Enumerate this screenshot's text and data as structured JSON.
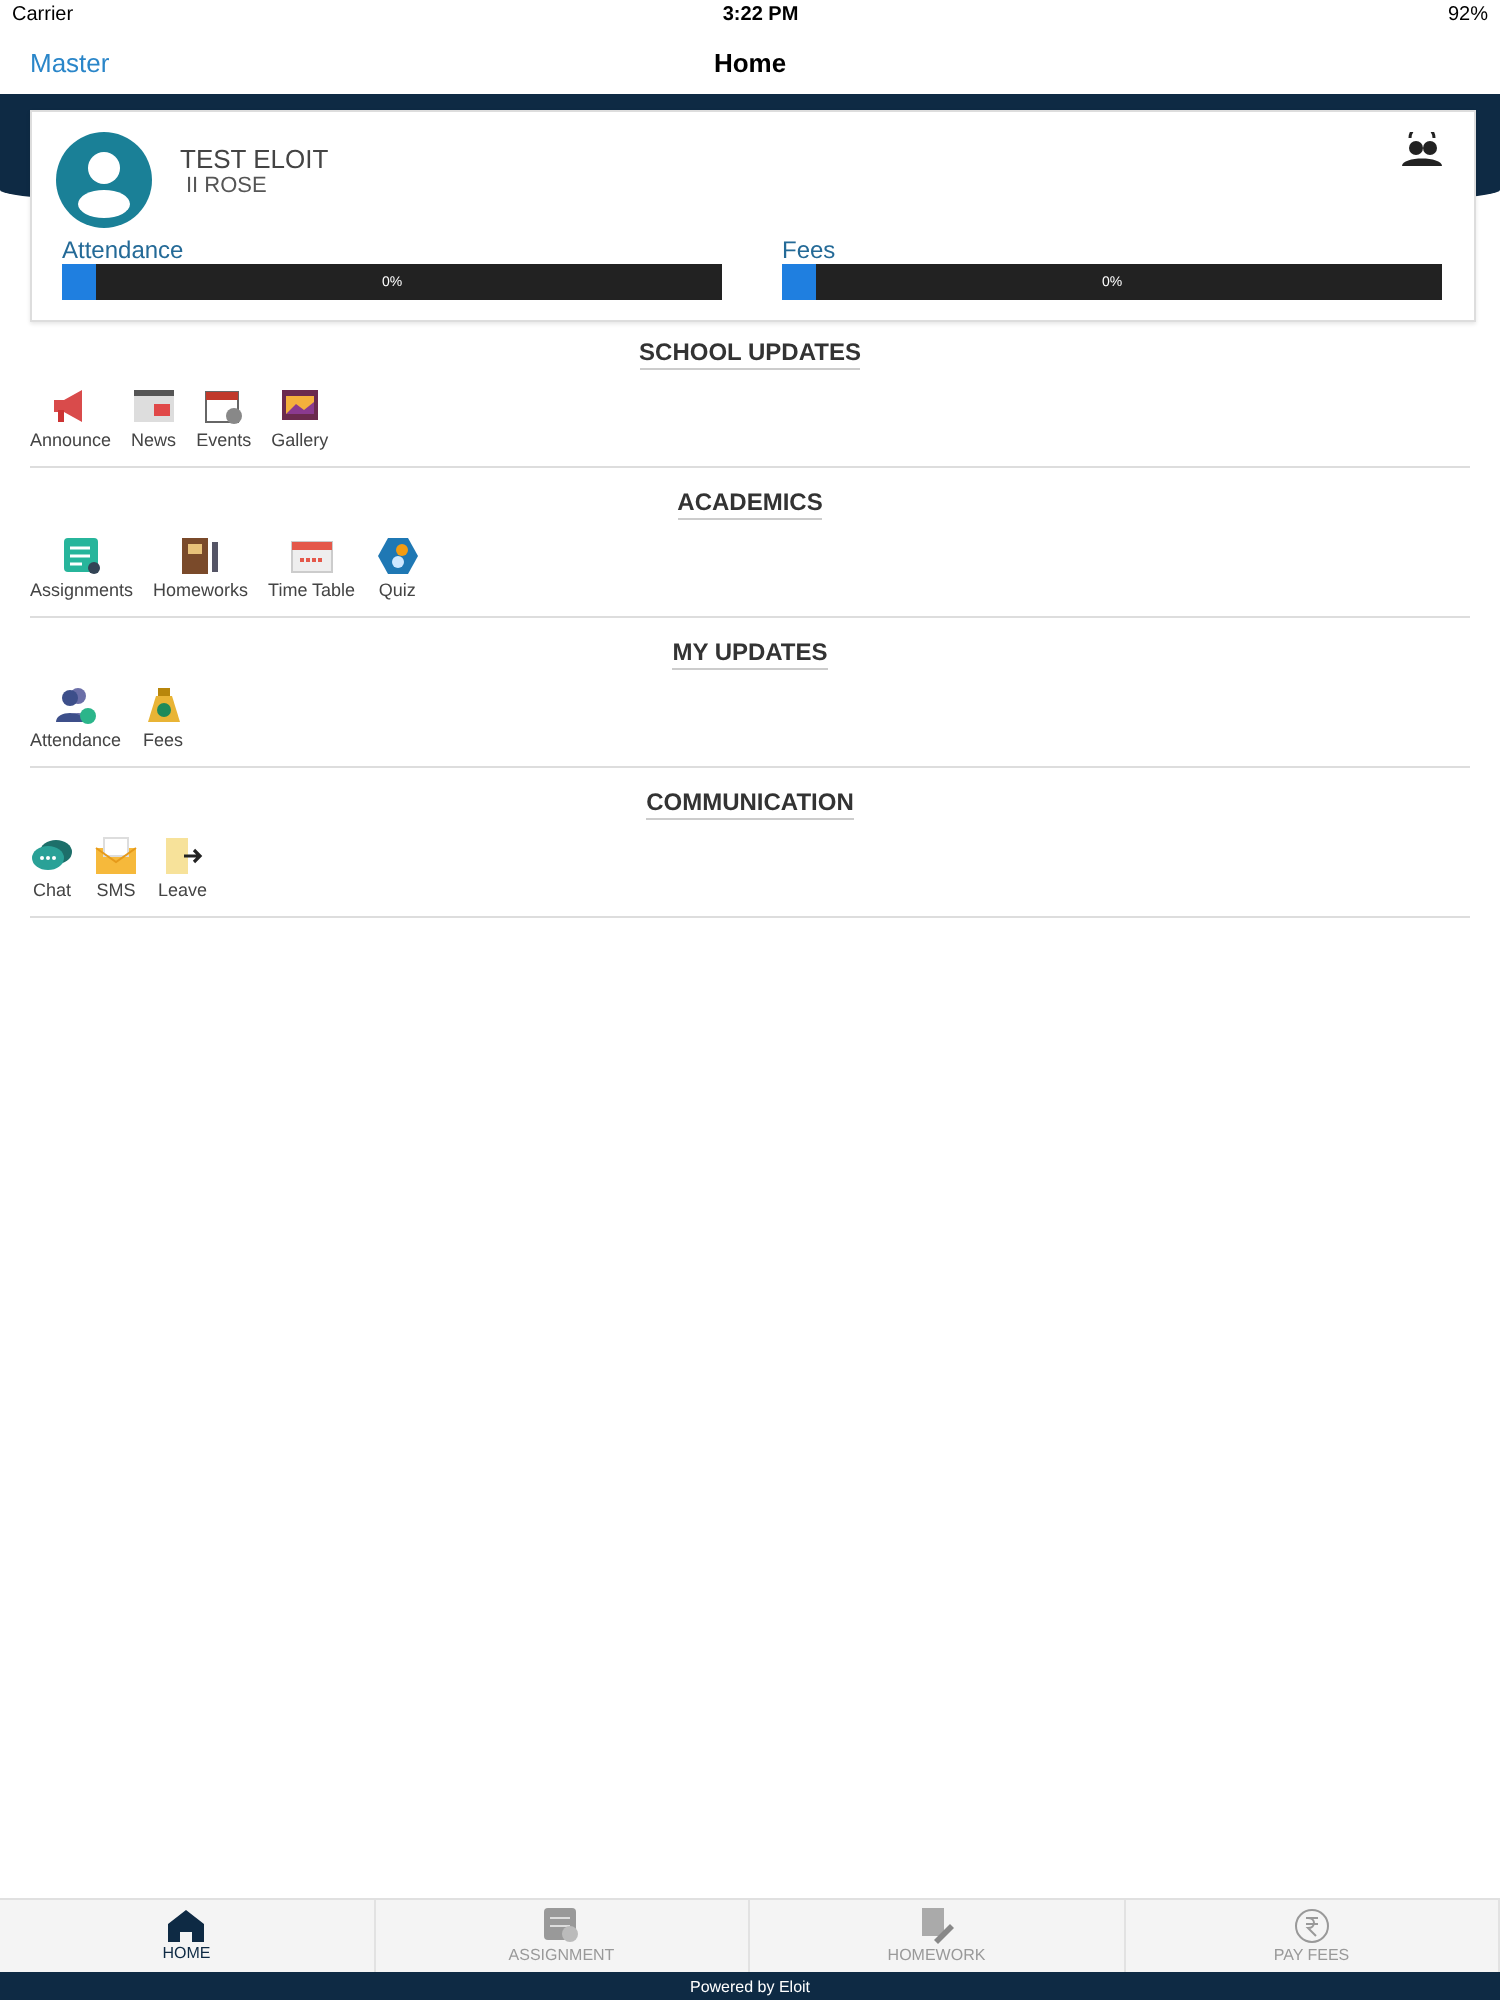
{
  "status_bar": {
    "carrier": "Carrier",
    "time": "3:22 PM",
    "battery": "92%"
  },
  "nav": {
    "back": "Master",
    "title": "Home"
  },
  "profile": {
    "name": "TEST ELOIT",
    "class": "II ROSE"
  },
  "meters": [
    {
      "label": "Attendance",
      "level": 0.05,
      "reading": "0%"
    },
    {
      "label": "Fees",
      "level": 0.05,
      "reading": "0%"
    }
  ],
  "sections": [
    {
      "title": "SCHOOL UPDATES",
      "items": [
        "Announce",
        "News",
        "Events",
        "Gallery"
      ]
    },
    {
      "title": "ACADEMICS",
      "items": [
        "Assignments",
        "Homeworks",
        "Time Table",
        "Quiz"
      ]
    },
    {
      "title": "MY UPDATES",
      "items": [
        "Attendance",
        "Fees"
      ]
    },
    {
      "title": "COMMUNICATION",
      "items": [
        "Chat",
        "SMS",
        "Leave"
      ]
    }
  ],
  "tabs": [
    {
      "label": "HOME",
      "selected": true
    },
    {
      "label": "ASSIGNMENT",
      "selected": false
    },
    {
      "label": "HOMEWORK",
      "selected": false
    },
    {
      "label": "PAY FEES",
      "selected": false
    }
  ],
  "footer": "Powered by Eloit"
}
